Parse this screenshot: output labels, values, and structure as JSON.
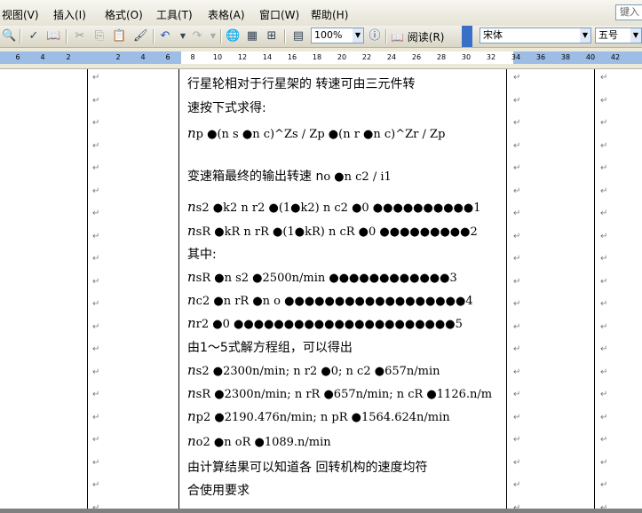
{
  "menu": {
    "items": [
      "视图(V)",
      "插入(I)",
      "格式(O)",
      "工具(T)",
      "表格(A)",
      "窗口(W)",
      "帮助(H)"
    ],
    "help_placeholder": "键入"
  },
  "toolbar": {
    "zoom": "100%",
    "reading": "阅读(R)",
    "font": "宋体",
    "size": "五号"
  },
  "ruler": {
    "labels": [
      "6",
      "4",
      "2",
      "2",
      "4",
      "6",
      "8",
      "10",
      "12",
      "14",
      "16",
      "18",
      "20",
      "22",
      "24",
      "26",
      "28",
      "30",
      "32",
      "34",
      "36",
      "38",
      "40",
      "42"
    ]
  },
  "doc": {
    "l1": "行星轮相对于行星架的 转速可由三元件转",
    "l2": "速按下式求得:",
    "l3": "n",
    "l4": "变速箱最终的输出转速 n",
    "l5": "n",
    "l6": "n",
    "l7": "其中:",
    "l8": "n",
    "l9": "n",
    "l10": "n",
    "l11": "由1～5式解方程组，可以得出",
    "l12": "n",
    "l13": "n",
    "l14": "n",
    "l15": "n",
    "l16": "由计算结果可以知道各 回转机构的速度均符",
    "l17": "合使用要求",
    "formula3": "p ●(n s ●n c)^Zs / Zp ●(n r ●n c)^Zr / Zp",
    "formula4": "o ●n c2 / i1",
    "formula5": "s2 ●k2 n r2 ●(1●k2) n c2 ●0 ●●●●●●●●●●1",
    "formula6": "sR ●kR n rR ●(1●kR) n cR ●0 ●●●●●●●●●2",
    "formula8": "sR ●n s2 ●2500n/min ●●●●●●●●●●●●3",
    "formula9": "c2 ●n rR ●n o ●●●●●●●●●●●●●●●●●●4",
    "formula10": "r2 ●0 ●●●●●●●●●●●●●●●●●●●●●●5",
    "formula12": "s2 ●2300n/min; n r2 ●0; n c2 ●657n/min",
    "formula13": "sR ●2300n/min; n rR ●657n/min; n cR ●1126.n/m",
    "formula14": "p2 ●2190.476n/min; n pR ●1564.624n/min",
    "formula15": "o2 ●n oR ●1089.n/min"
  }
}
